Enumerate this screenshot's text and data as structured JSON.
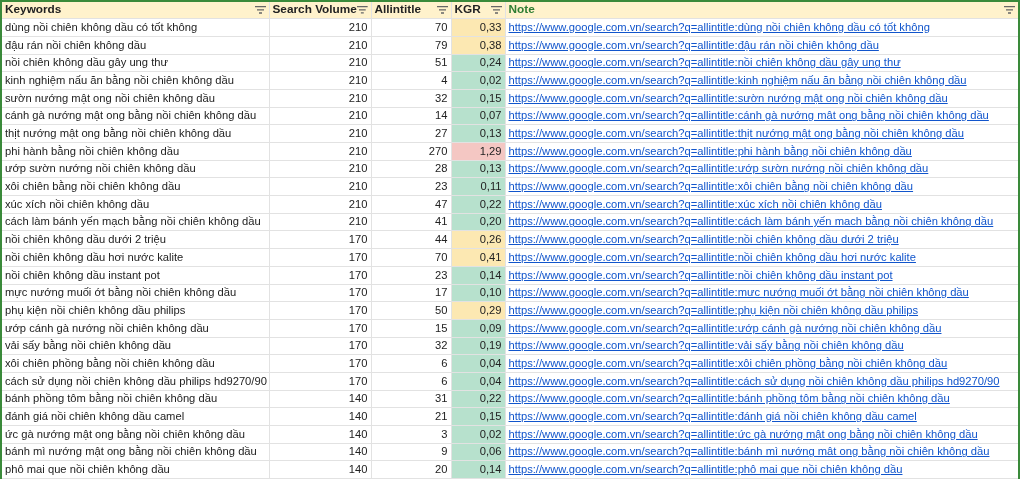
{
  "columns": [
    {
      "label": "Keywords",
      "selected": false
    },
    {
      "label": "Search Volume",
      "selected": false
    },
    {
      "label": "Allintitle",
      "selected": false
    },
    {
      "label": "KGR",
      "selected": false
    },
    {
      "label": "Note",
      "selected": true
    }
  ],
  "rows": [
    {
      "keyword": "dùng nồi chiên không dầu có tốt không",
      "volume": "210",
      "allintitle": "70",
      "kgr": "0,33",
      "color": "#fce8b2",
      "note": "https://www.google.com.vn/search?q=allintitle:dùng nồi chiên không dầu có tốt không"
    },
    {
      "keyword": "đậu rán nồi chiên không dầu",
      "volume": "210",
      "allintitle": "79",
      "kgr": "0,38",
      "color": "#fce8b2",
      "note": "https://www.google.com.vn/search?q=allintitle:đậu rán nồi chiên không dầu"
    },
    {
      "keyword": "nồi chiên không dầu gây ung thư",
      "volume": "210",
      "allintitle": "51",
      "kgr": "0,24",
      "color": "#b7e1cd",
      "note": "https://www.google.com.vn/search?q=allintitle:nồi chiên không dầu gây ung thư"
    },
    {
      "keyword": "kinh nghiệm nấu ăn bằng nồi chiên không dầu",
      "volume": "210",
      "allintitle": "4",
      "kgr": "0,02",
      "color": "#b7e1cd",
      "note": "https://www.google.com.vn/search?q=allintitle:kinh nghiệm nấu ăn bằng nồi chiên không dầu"
    },
    {
      "keyword": "sườn nướng mật ong nồi chiên không dầu",
      "volume": "210",
      "allintitle": "32",
      "kgr": "0,15",
      "color": "#b7e1cd",
      "note": "https://www.google.com.vn/search?q=allintitle:sườn nướng mật ong nồi chiên không dầu"
    },
    {
      "keyword": "cánh gà nướng mật ong bằng nồi chiên không dầu",
      "volume": "210",
      "allintitle": "14",
      "kgr": "0,07",
      "color": "#b7e1cd",
      "note": "https://www.google.com.vn/search?q=allintitle:cánh gà nướng mật ong bằng nồi chiên không dầu"
    },
    {
      "keyword": "thịt nướng mật ong bằng nồi chiên không dầu",
      "volume": "210",
      "allintitle": "27",
      "kgr": "0,13",
      "color": "#b7e1cd",
      "note": "https://www.google.com.vn/search?q=allintitle:thịt nướng mật ong bằng nồi chiên không dầu"
    },
    {
      "keyword": "phi hành bằng nồi chiên không dầu",
      "volume": "210",
      "allintitle": "270",
      "kgr": "1,29",
      "color": "#f4c7c3",
      "note": "https://www.google.com.vn/search?q=allintitle:phi hành bằng nồi chiên không dầu"
    },
    {
      "keyword": "ướp sườn nướng nồi chiên không dầu",
      "volume": "210",
      "allintitle": "28",
      "kgr": "0,13",
      "color": "#b7e1cd",
      "note": "https://www.google.com.vn/search?q=allintitle:ướp sườn nướng nồi chiên không dầu"
    },
    {
      "keyword": "xôi chiên bằng nồi chiên không dầu",
      "volume": "210",
      "allintitle": "23",
      "kgr": "0,11",
      "color": "#b7e1cd",
      "note": "https://www.google.com.vn/search?q=allintitle:xôi chiên bằng nồi chiên không dầu"
    },
    {
      "keyword": "xúc xích nồi chiên không dầu",
      "volume": "210",
      "allintitle": "47",
      "kgr": "0,22",
      "color": "#b7e1cd",
      "note": "https://www.google.com.vn/search?q=allintitle:xúc xích nồi chiên không dầu"
    },
    {
      "keyword": "cách làm bánh yến mạch bằng nồi chiên không dầu",
      "volume": "210",
      "allintitle": "41",
      "kgr": "0,20",
      "color": "#b7e1cd",
      "note": "https://www.google.com.vn/search?q=allintitle:cách làm bánh yến mạch bằng nồi chiên không dầu"
    },
    {
      "keyword": "nồi chiên không dầu dưới 2 triệu",
      "volume": "170",
      "allintitle": "44",
      "kgr": "0,26",
      "color": "#fce8b2",
      "note": "https://www.google.com.vn/search?q=allintitle:nồi chiên không dầu dưới 2 triệu"
    },
    {
      "keyword": "nồi chiên không dầu hơi nước kalite",
      "volume": "170",
      "allintitle": "70",
      "kgr": "0,41",
      "color": "#fce8b2",
      "note": "https://www.google.com.vn/search?q=allintitle:nồi chiên không dầu hơi nước kalite"
    },
    {
      "keyword": "nồi chiên không dầu instant pot",
      "volume": "170",
      "allintitle": "23",
      "kgr": "0,14",
      "color": "#b7e1cd",
      "note": "https://www.google.com.vn/search?q=allintitle:nồi chiên không dầu instant pot"
    },
    {
      "keyword": "mực nướng muối ớt bằng nồi chiên không dầu",
      "volume": "170",
      "allintitle": "17",
      "kgr": "0,10",
      "color": "#b7e1cd",
      "note": "https://www.google.com.vn/search?q=allintitle:mực nướng muối ớt bằng nồi chiên không dầu"
    },
    {
      "keyword": "phụ kiện nồi chiên không dầu philips",
      "volume": "170",
      "allintitle": "50",
      "kgr": "0,29",
      "color": "#fce8b2",
      "note": "https://www.google.com.vn/search?q=allintitle:phụ kiện nồi chiên không dầu philips"
    },
    {
      "keyword": "ướp cánh gà nướng nồi chiên không dầu",
      "volume": "170",
      "allintitle": "15",
      "kgr": "0,09",
      "color": "#b7e1cd",
      "note": "https://www.google.com.vn/search?q=allintitle:ướp cánh gà nướng nồi chiên không dầu"
    },
    {
      "keyword": "vải sấy bằng nồi chiên không dầu",
      "volume": "170",
      "allintitle": "32",
      "kgr": "0,19",
      "color": "#b7e1cd",
      "note": "https://www.google.com.vn/search?q=allintitle:vải sấy bằng nồi chiên không dầu"
    },
    {
      "keyword": "xôi chiên phồng bằng nồi chiên không dầu",
      "volume": "170",
      "allintitle": "6",
      "kgr": "0,04",
      "color": "#b7e1cd",
      "note": "https://www.google.com.vn/search?q=allintitle:xôi chiên phồng bằng nồi chiên không dầu"
    },
    {
      "keyword": "cách sử dụng nồi chiên không dầu philips hd9270/90",
      "volume": "170",
      "allintitle": "6",
      "kgr": "0,04",
      "color": "#b7e1cd",
      "note": "https://www.google.com.vn/search?q=allintitle:cách sử dụng nồi chiên không dầu philips hd9270/90"
    },
    {
      "keyword": "bánh phồng tôm bằng nồi chiên không dầu",
      "volume": "140",
      "allintitle": "31",
      "kgr": "0,22",
      "color": "#b7e1cd",
      "note": "https://www.google.com.vn/search?q=allintitle:bánh phồng tôm bằng nồi chiên không dầu"
    },
    {
      "keyword": "đánh giá nồi chiên không dầu camel",
      "volume": "140",
      "allintitle": "21",
      "kgr": "0,15",
      "color": "#b7e1cd",
      "note": "https://www.google.com.vn/search?q=allintitle:đánh giá nồi chiên không dầu camel"
    },
    {
      "keyword": "ức gà nướng mật ong bằng nồi chiên không dầu",
      "volume": "140",
      "allintitle": "3",
      "kgr": "0,02",
      "color": "#b7e1cd",
      "note": "https://www.google.com.vn/search?q=allintitle:ức gà nướng mật ong bằng nồi chiên không dầu"
    },
    {
      "keyword": "bánh mì nướng mật ong bằng nồi chiên không dầu",
      "volume": "140",
      "allintitle": "9",
      "kgr": "0,06",
      "color": "#b7e1cd",
      "note": "https://www.google.com.vn/search?q=allintitle:bánh mì nướng mật ong bằng nồi chiên không dầu"
    },
    {
      "keyword": "phô mai que nồi chiên không dầu",
      "volume": "140",
      "allintitle": "20",
      "kgr": "0,14",
      "color": "#b7e1cd",
      "note": "https://www.google.com.vn/search?q=allintitle:phô mai que nồi chiên không dầu"
    }
  ]
}
